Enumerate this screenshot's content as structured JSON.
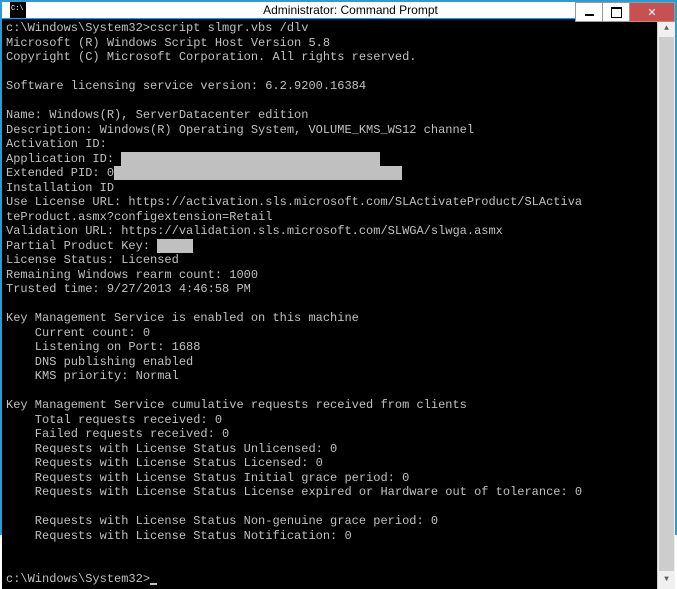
{
  "window": {
    "title": "Administrator: Command Prompt"
  },
  "prompt1": {
    "path": "c:\\Windows\\System32>",
    "command": "cscript slmgr.vbs /dlv"
  },
  "header": {
    "line1": "Microsoft (R) Windows Script Host Version 5.8",
    "line2": "Copyright (C) Microsoft Corporation. All rights reserved."
  },
  "svc_version": "Software licensing service version: 6.2.9200.16384",
  "info": {
    "name": "Name: Windows(R), ServerDatacenter edition",
    "description": "Description: Windows(R) Operating System, VOLUME_KMS_WS12 channel",
    "activation_id_label": "Activation ID:",
    "application_id_label": "Application ID:",
    "extended_pid_label": "Extended PID: 0",
    "installation_id_label": "Installation ID",
    "use_license_url": "Use License URL: https://activation.sls.microsoft.com/SLActivateProduct/SLActiva\nteProduct.asmx?configextension=Retail",
    "validation_url": "Validation URL: https://validation.sls.microsoft.com/SLWGA/slwga.asmx",
    "partial_key_label": "Partial Product Key:",
    "license_status": "License Status: Licensed",
    "rearm_count": "Remaining Windows rearm count: 1000",
    "trusted_time": "Trusted time: 9/27/2013 4:46:58 PM"
  },
  "kms_enabled": {
    "heading": "Key Management Service is enabled on this machine",
    "current_count": "    Current count: 0",
    "listening": "    Listening on Port: 1688",
    "dns": "    DNS publishing enabled",
    "priority": "    KMS priority: Normal"
  },
  "kms_requests": {
    "heading": "Key Management Service cumulative requests received from clients",
    "total": "    Total requests received: 0",
    "failed": "    Failed requests received: 0",
    "unlicensed": "    Requests with License Status Unlicensed: 0",
    "licensed": "    Requests with License Status Licensed: 0",
    "initial_grace": "    Requests with License Status Initial grace period: 0",
    "expired": "    Requests with License Status License expired or Hardware out of tolerance: 0",
    "blank": "",
    "nongenuine": "    Requests with License Status Non-genuine grace period: 0",
    "notification": "    Requests with License Status Notification: 0"
  },
  "prompt2": {
    "path": "c:\\Windows\\System32>"
  }
}
